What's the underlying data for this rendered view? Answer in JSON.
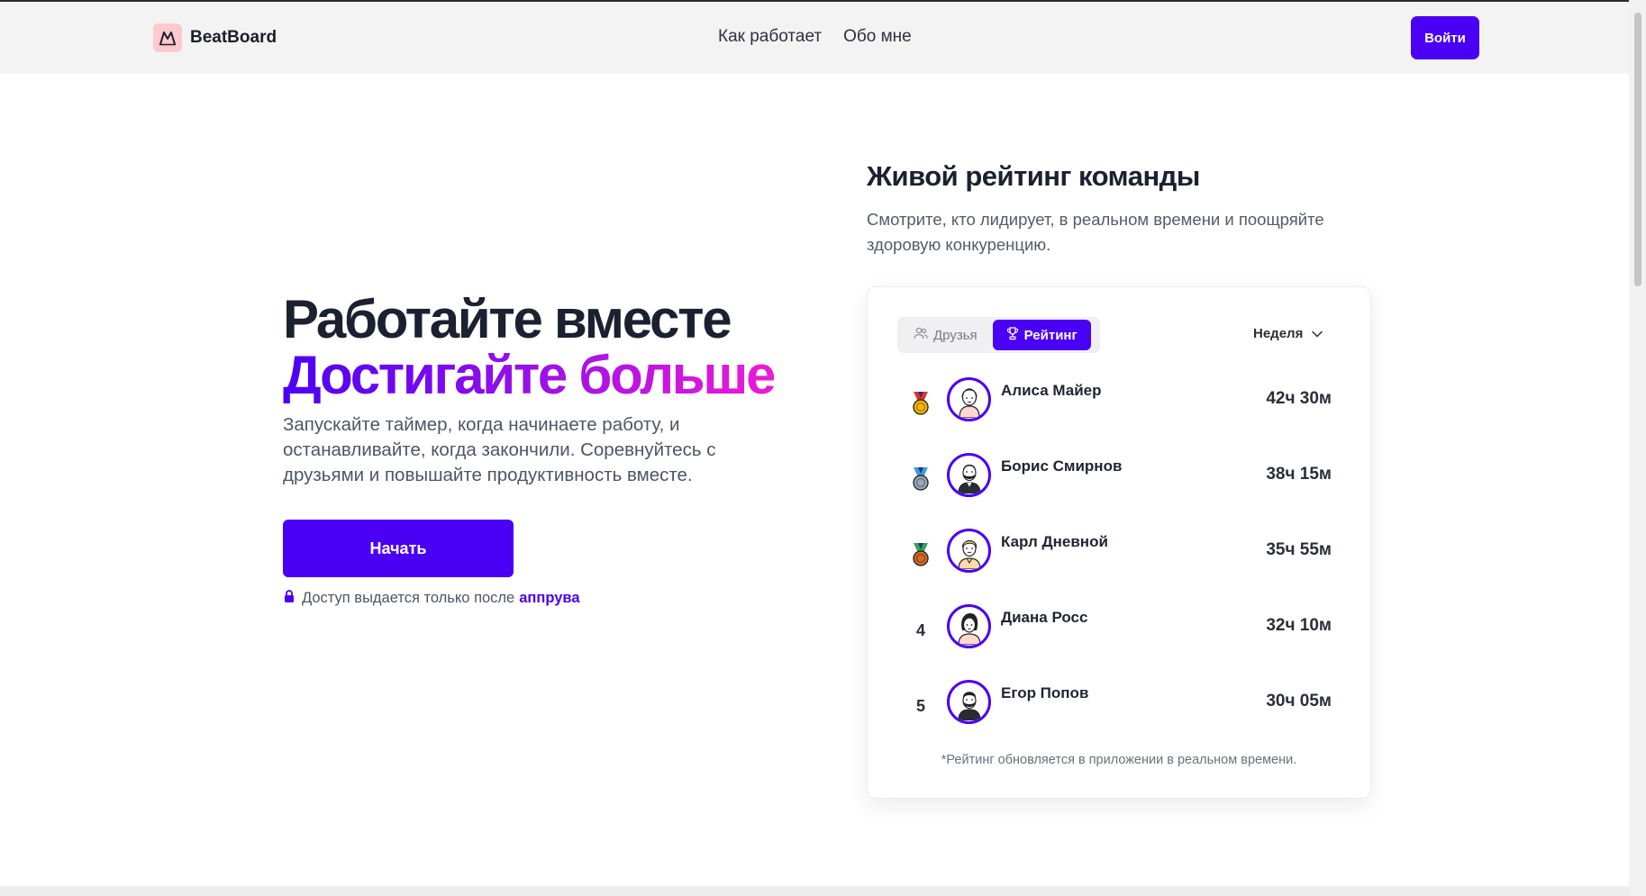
{
  "header": {
    "logo_text": "BeatBoard",
    "nav": [
      {
        "label": "Как работает"
      },
      {
        "label": "Обо мне"
      }
    ],
    "login_label": "Войти"
  },
  "hero": {
    "title_line1": "Работайте вместе",
    "title_line2": "Достигайте больше",
    "subtitle": "Запускайте таймер, когда начинаете работу, и останавливайте, когда закончили. Соревнуйтесь с друзьями и повышайте продуктивность вместе.",
    "cta_label": "Начать",
    "access_text": "Доступ выдается только после",
    "access_link": "аппрува"
  },
  "leaderboard": {
    "title": "Живой рейтинг команды",
    "subtitle": "Смотрите, кто лидирует, в реальном времени и поощряйте здоровую конкуренцию.",
    "tabs": [
      {
        "label": "Друзья",
        "icon": "users-icon",
        "active": false
      },
      {
        "label": "Рейтинг",
        "icon": "trophy-icon",
        "active": true
      }
    ],
    "period": "Неделя",
    "entries": [
      {
        "place": "",
        "medal": "gold-medal-icon",
        "name": "Алиса Майер",
        "time": "42ч 30м"
      },
      {
        "place": "",
        "medal": "silver-medal-icon",
        "name": "Борис Смирнов",
        "time": "38ч 15м"
      },
      {
        "place": "",
        "medal": "bronze-medal-icon",
        "name": "Карл Дневной",
        "time": "35ч 55м"
      },
      {
        "place": "4",
        "medal": "",
        "name": "Диана Росс",
        "time": "32ч 10м"
      },
      {
        "place": "5",
        "medal": "",
        "name": "Егор Попов",
        "time": "30ч 05м"
      }
    ],
    "footnote": "*Рейтинг обновляется в приложении в реальном времени."
  },
  "colors": {
    "accent": "#4a00f5",
    "gradient_end": "#ec1bd5",
    "gold": "#f2b705",
    "silver": "#9aa7b4",
    "bronze": "#d06a2a"
  }
}
